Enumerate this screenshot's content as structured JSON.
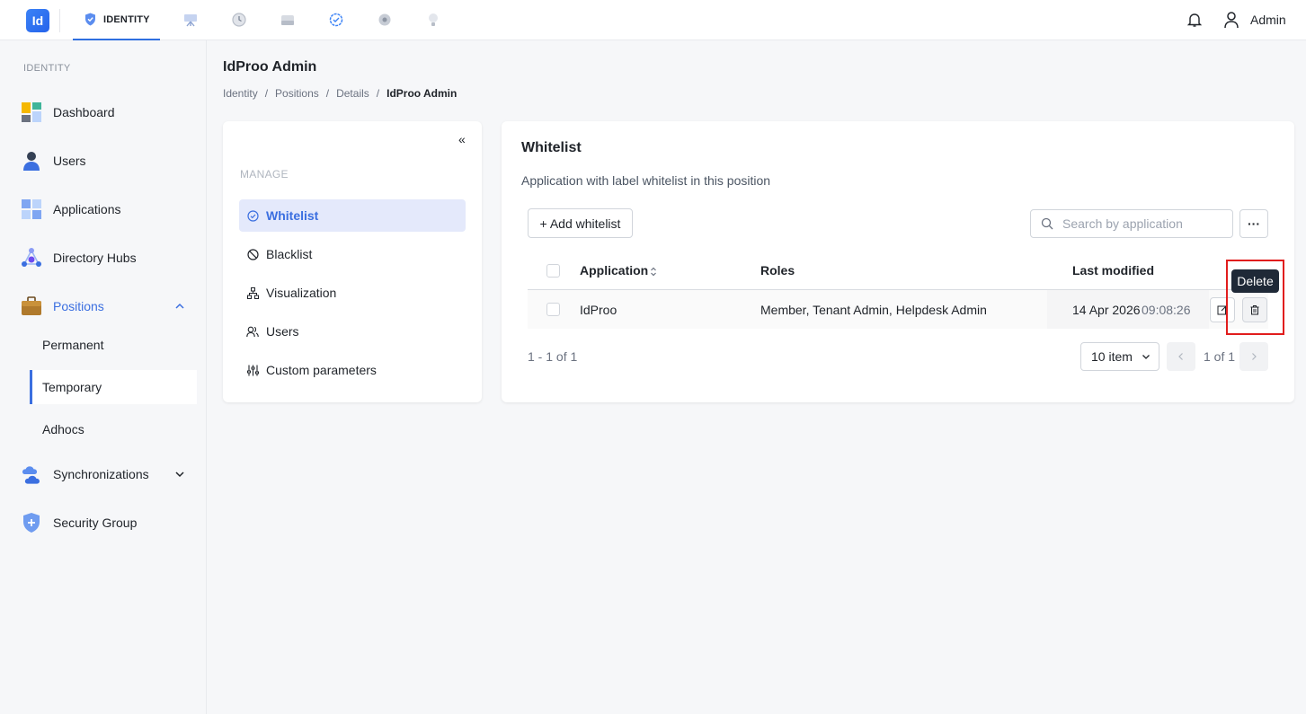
{
  "topbar": {
    "logo_text": "Id",
    "active_tab": "IDENTITY",
    "user_label": "Admin"
  },
  "sidebar": {
    "section_label": "IDENTITY",
    "items": [
      {
        "label": "Dashboard",
        "icon": "dashboard-icon"
      },
      {
        "label": "Users",
        "icon": "user-icon"
      },
      {
        "label": "Applications",
        "icon": "applications-icon"
      },
      {
        "label": "Directory Hubs",
        "icon": "directory-hubs-icon"
      },
      {
        "label": "Positions",
        "icon": "briefcase-icon"
      },
      {
        "label": "Synchronizations",
        "icon": "cloud-sync-icon"
      },
      {
        "label": "Security Group",
        "icon": "shield-icon"
      }
    ],
    "positions_sub": [
      "Permanent",
      "Temporary",
      "Adhocs"
    ]
  },
  "header": {
    "title": "IdProo Admin",
    "breadcrumb": [
      "Identity",
      "/",
      "Positions",
      "/",
      "Details",
      "/",
      "IdProo Admin"
    ]
  },
  "manage": {
    "collapse_label": "«",
    "section_label": "MANAGE",
    "items": [
      "Whitelist",
      "Blacklist",
      "Visualization",
      "Users",
      "Custom parameters"
    ]
  },
  "whitelist": {
    "title": "Whitelist",
    "description": "Application with label whitelist in this position",
    "add_button": "+ Add whitelist",
    "search_placeholder": "Search by application",
    "more_label": "···",
    "columns": [
      "Application",
      "Roles",
      "Last modified"
    ],
    "rows": [
      {
        "application": "IdProo",
        "roles": "Member, Tenant Admin, Helpdesk Admin",
        "date": "14 Apr 2026",
        "time": "09:08:26"
      }
    ],
    "tooltip": "Delete",
    "pager_info": "1 - 1 of 1",
    "page_size": "10 item",
    "page_text": "1 of 1"
  },
  "colors": {
    "accent": "#3b6fe0",
    "highlight": "#e11d1d"
  }
}
